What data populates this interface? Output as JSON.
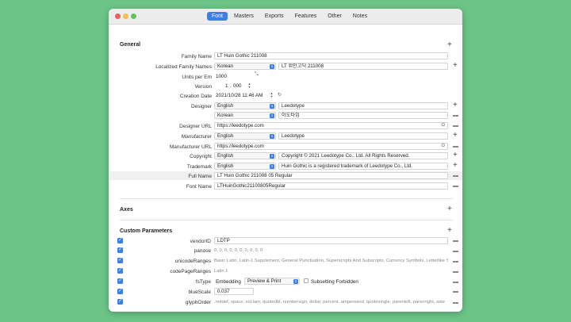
{
  "tabs": [
    {
      "label": "Font",
      "active": true
    },
    {
      "label": "Masters"
    },
    {
      "label": "Exports"
    },
    {
      "label": "Features"
    },
    {
      "label": "Other"
    },
    {
      "label": "Notes"
    }
  ],
  "colors": {
    "accent": "#3d7fe6",
    "close": "#ec5f59",
    "minimize": "#f4be4f",
    "zoom": "#5fc453",
    "background": "#6cc487"
  },
  "general": {
    "title": "General",
    "family_name_label": "Family Name",
    "family_name_value": "LT Huin Gothic 211008",
    "localized_label": "Localized Family Names",
    "localized_lang": "Korean",
    "localized_value": "LT 휘인고딕 211008",
    "upm_label": "Units per Em",
    "upm_value": "1000",
    "version_label": "Version",
    "version_major": "1",
    "version_minor": "000",
    "version_sep": ".",
    "date_label": "Creation Date",
    "date_value": "2021/10/28 11:46 AM",
    "designer_label": "Designer",
    "designer_lang_1": "English",
    "designer_value_1": "Leedotype",
    "designer_lang_2": "Korean",
    "designer_value_2": "이도타입",
    "designer_url_label": "Designer URL",
    "designer_url_value": "https://leedotype.com",
    "manufacturer_label": "Manufacturer",
    "manufacturer_lang": "English",
    "manufacturer_value": "Leedotype",
    "manufacturer_url_label": "Manufacturer URL",
    "manufacturer_url_value": "https://leedotype.com",
    "copyright_label": "Copyright",
    "copyright_lang": "English",
    "copyright_value": "Copyright © 2021 Leedotype Co., Ltd. All Rights Reserved.",
    "trademark_label": "Trademark",
    "trademark_lang": "English",
    "trademark_value": "Huin Gothic is a registered trademark of Leedotype Co., Ltd.",
    "fullname_label": "Full Name",
    "fullname_value": "LT Huin Gothic 211008 05 Regular",
    "fontname_label": "Font Name",
    "fontname_value": "LTHuinGothic21100805Regular"
  },
  "axes": {
    "title": "Axes"
  },
  "custom": {
    "title": "Custom Parameters",
    "vendorID_label": "vendorID",
    "vendorID_value": "LDTP",
    "panose_label": "panose",
    "panose_value": "0, 0, 0, 0, 0, 0, 0, 0, 0, 0",
    "unicode_label": "unicodeRanges",
    "unicode_value": "Basic Latin, Latin-1 Supplement, General Punctuation, Superscripts And Subscripts, Currency Symbols, Letterlike S",
    "codepage_label": "codePageRanges",
    "codepage_value": "Latin 1",
    "fstype_label": "fsType",
    "fstype_embedding": "Embedding",
    "fstype_select": "Preview & Print",
    "fstype_subsetting": "Subsetting Forbidden",
    "bluescale_label": "blueScale",
    "bluescale_value": "0.037",
    "glyphorder_label": "glyphOrder",
    "glyphorder_value": ".notdef, space, exclam, quotedbl, numbersign, dollar, percent, ampersand, quotesingle, parenleft, parenright, aste"
  }
}
